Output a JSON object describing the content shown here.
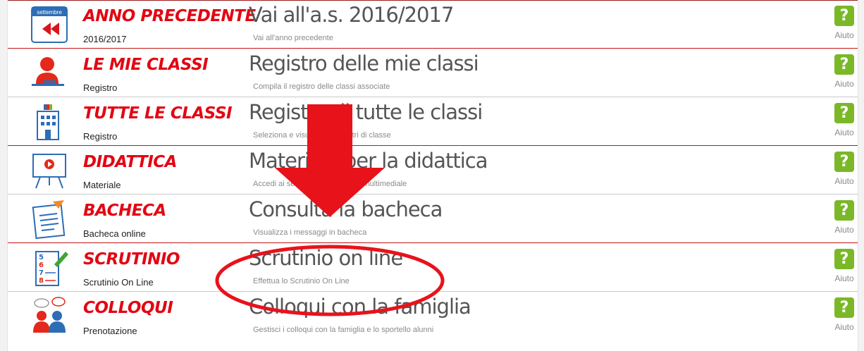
{
  "menu": {
    "help_label": "Aiuto",
    "help_glyph": "?",
    "items": [
      {
        "icon": "calendar-rewind-icon",
        "title": "ANNO PRECEDENTE",
        "subtitle": "2016/2017",
        "action": "Vai all'a.s. 2016/2017",
        "description": "Vai all'anno precedente"
      },
      {
        "icon": "teacher-desk-icon",
        "title": "LE MIE CLASSI",
        "subtitle": "Registro",
        "action": "Registro delle mie classi",
        "description": "Compila il registro delle classi associate"
      },
      {
        "icon": "school-building-icon",
        "title": "TUTTE LE CLASSI",
        "subtitle": "Registro",
        "action": "Registro di tutte le classi",
        "description": "Seleziona e visualizza i registri di classe"
      },
      {
        "icon": "video-board-icon",
        "title": "DIDATTICA",
        "subtitle": "Materiale",
        "action": "Materiale per la didattica",
        "description": "Accedi ai servizi per la didattica multimediale"
      },
      {
        "icon": "notice-board-icon",
        "title": "BACHECA",
        "subtitle": "Bacheca online",
        "action": "Consulta la bacheca",
        "description": "Visualizza i messaggi in bacheca"
      },
      {
        "icon": "grades-list-icon",
        "title": "SCRUTINIO",
        "subtitle": "Scrutinio On Line",
        "action": "Scrutinio on line",
        "description": "Effettua lo Scrutinio On Line"
      },
      {
        "icon": "meeting-people-icon",
        "title": "COLLOQUI",
        "subtitle": "Prenotazione",
        "action": "Colloqui con la famiglia",
        "description": "Gestisci i colloqui con la famiglia e lo sportello alunni"
      }
    ]
  },
  "icon_texts": {
    "calendar_month": "settembre",
    "grade_numbers": [
      "5",
      "6",
      "7",
      "8"
    ]
  },
  "colors": {
    "title_red": "#e30613",
    "help_green": "#7ab828",
    "annotation_red": "#e8121b"
  }
}
